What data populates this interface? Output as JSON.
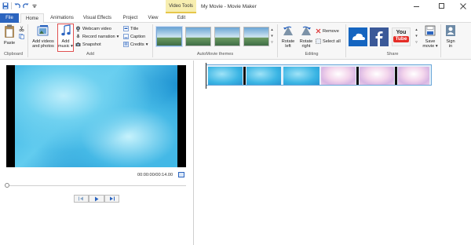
{
  "window": {
    "title": "My Movie - Movie Maker",
    "contextual_tab_group": "Video Tools"
  },
  "tabs": [
    "File",
    "Home",
    "Animations",
    "Visual Effects",
    "Project",
    "View",
    "Edit"
  ],
  "ribbon": {
    "clipboard": {
      "paste": "Paste",
      "label": "Clipboard"
    },
    "add": {
      "add_videos_line1": "Add videos",
      "add_videos_line2": "and photos",
      "add_music_line1": "Add",
      "add_music_line2": "music",
      "webcam_video": "Webcam video",
      "record_narration": "Record narration",
      "snapshot": "Snapshot",
      "title": "Title",
      "caption": "Caption",
      "credits": "Credits",
      "label": "Add"
    },
    "themes": {
      "label": "AutoMovie themes"
    },
    "editing": {
      "rotate_left_line1": "Rotate",
      "rotate_left_line2": "left",
      "rotate_right_line1": "Rotate",
      "rotate_right_line2": "right",
      "remove": "Remove",
      "select_all": "Select all",
      "label": "Editing"
    },
    "share": {
      "save_movie_line1": "Save",
      "save_movie_line2": "movie",
      "sign_in_line1": "Sign",
      "sign_in_line2": "in",
      "youtube_line1": "You",
      "youtube_line2": "Tube",
      "label": "Share"
    }
  },
  "preview": {
    "timecode": "00:00:00/00:14.00"
  },
  "colors": {
    "accent": "#2b64bf",
    "contextual_tab": "#f7eeb0",
    "onedrive": "#1565c0",
    "facebook": "#3b5998",
    "youtube": "#e52d27"
  }
}
